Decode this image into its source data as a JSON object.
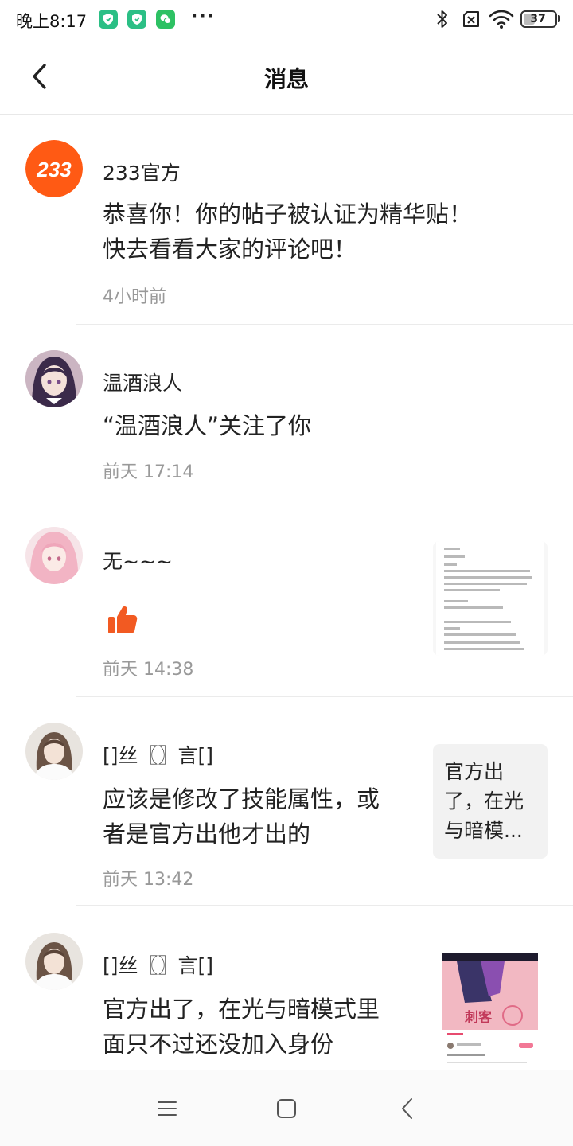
{
  "status_bar": {
    "time": "晚上8:17",
    "dots": "···",
    "battery": "37",
    "battery_level_percent": 37,
    "icons": [
      "shield-icon",
      "shield-icon",
      "wechat-icon",
      "bluetooth-icon",
      "sim-off-icon",
      "wifi-icon",
      "battery-icon"
    ]
  },
  "header": {
    "title": "消息",
    "back_icon": "chevron-left-icon"
  },
  "messages": [
    {
      "sender": "233官方",
      "avatar_text": "233",
      "avatar_color": "#ff5a14",
      "text": "恭喜你！你的帖子被认证为精华贴！\n快去看看大家的评论吧！",
      "time": "4小时前"
    },
    {
      "sender": "温酒浪人",
      "text": "“温酒浪人”关注了你",
      "time": "前天 17:14"
    },
    {
      "sender": "无~~~",
      "icon": "thumbs-up-icon",
      "icon_color": "#f25a22",
      "time": "前天 14:38",
      "thumb": "document-thumbnail"
    },
    {
      "sender": "[]丝〖〗言[]",
      "text": "应该是修改了技能属性，或\n者是官方出他才出的",
      "time": "前天 13:42",
      "quote": "官方出了，在光与暗模..."
    },
    {
      "sender": "[]丝〖〗言[]",
      "text": "官方出了，在光与暗模式里\n面只不过还没加入身份",
      "thumb": "image-thumbnail",
      "thumb_label": "刺客"
    }
  ],
  "nav_bar": {
    "icons": [
      "menu-icon",
      "home-square-icon",
      "back-triangle-icon"
    ]
  }
}
